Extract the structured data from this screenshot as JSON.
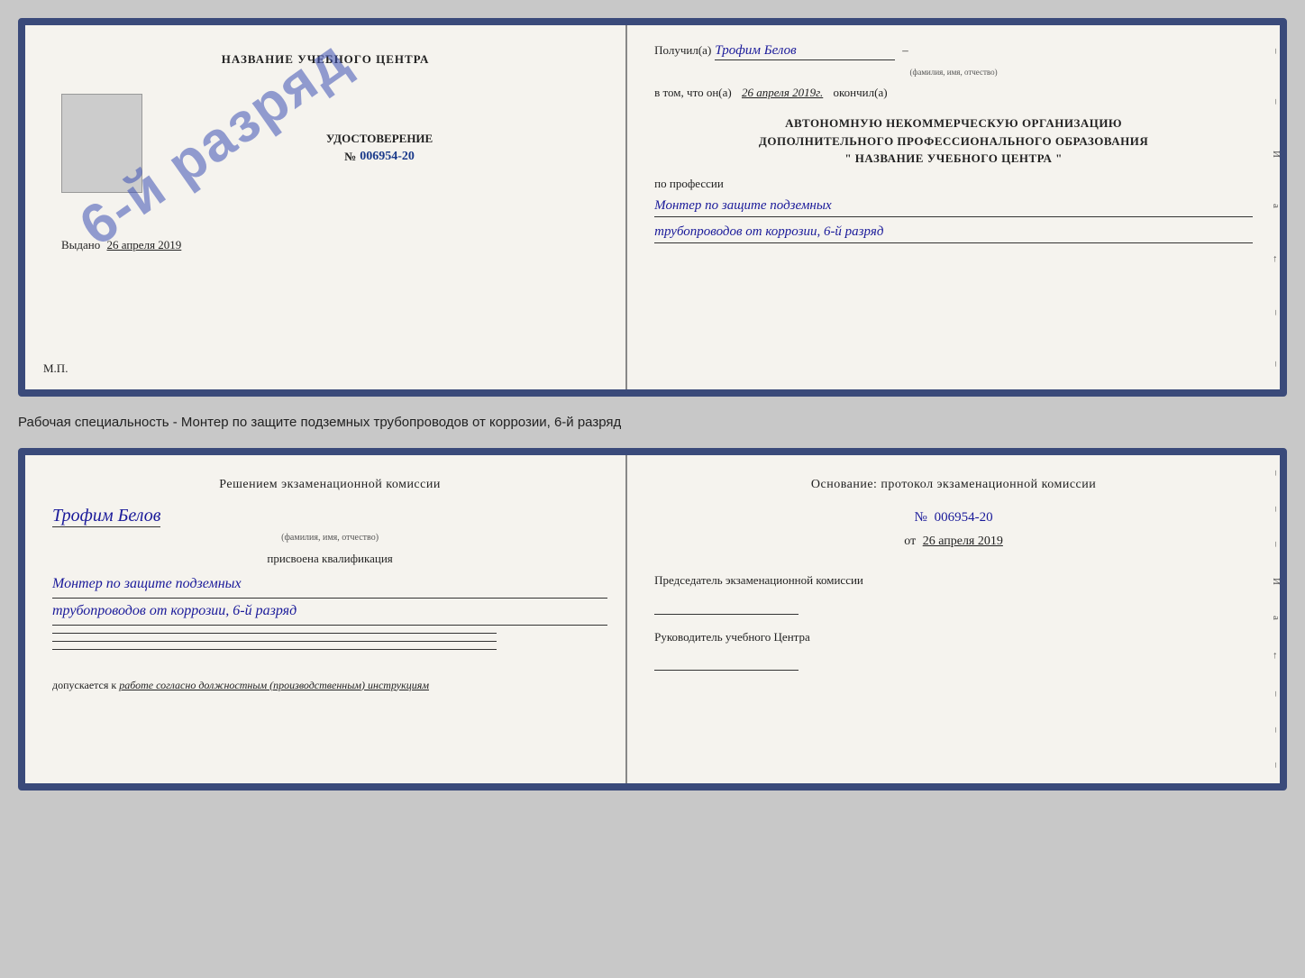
{
  "page": {
    "background": "#c8c8c8"
  },
  "top_certificate": {
    "left": {
      "title": "НАЗВАНИЕ УЧЕБНОГО ЦЕНТРА",
      "stamp_text": "6-й разряд",
      "cert_label": "УДОСТОВЕРЕНИЕ",
      "cert_number_prefix": "№",
      "cert_number": "006954-20",
      "issued_label": "Выдано",
      "issued_date": "26 апреля 2019",
      "mp_label": "М.П."
    },
    "right": {
      "received_label": "Получил(а)",
      "received_name": "Трофим Белов",
      "received_sub": "(фамилия, имя, отчество)",
      "date_label": "в том, что он(а)",
      "date_value": "26 апреля 2019г.",
      "finished_label": "окончил(а)",
      "org_line1": "АВТОНОМНУЮ НЕКОММЕРЧЕСКУЮ ОРГАНИЗАЦИЮ",
      "org_line2": "ДОПОЛНИТЕЛЬНОГО ПРОФЕССИОНАЛЬНОГО ОБРАЗОВАНИЯ",
      "org_line3": "\" НАЗВАНИЕ УЧЕБНОГО ЦЕНТРА \"",
      "profession_label": "по профессии",
      "profession_line1": "Монтер по защите подземных",
      "profession_line2": "трубопроводов от коррозии, 6-й разряд",
      "side_marks": [
        "–",
        "–",
        "И",
        "а",
        "←",
        "–",
        "–",
        "–"
      ]
    }
  },
  "specialty_label": "Рабочая специальность - Монтер по защите подземных трубопроводов от коррозии, 6-й разряд",
  "bottom_certificate": {
    "left": {
      "decision_title": "Решением экзаменационной комиссии",
      "person_name": "Трофим Белов",
      "person_sub": "(фамилия, имя, отчество)",
      "assigned_label": "присвоена квалификация",
      "qual_line1": "Монтер по защите подземных",
      "qual_line2": "трубопроводов от коррозии, 6-й разряд",
      "admit_label": "допускается к",
      "admit_text": "работе согласно должностным (производственным) инструкциям"
    },
    "right": {
      "basis_title": "Основание: протокол экзаменационной комиссии",
      "protocol_prefix": "№",
      "protocol_number": "006954-20",
      "date_prefix": "от",
      "date_value": "26 апреля 2019",
      "chairman_label": "Председатель экзаменационной комиссии",
      "director_label": "Руководитель учебного Центра",
      "side_marks": [
        "–",
        "–",
        "–",
        "И",
        "а",
        "←",
        "–",
        "–",
        "–"
      ]
    }
  }
}
